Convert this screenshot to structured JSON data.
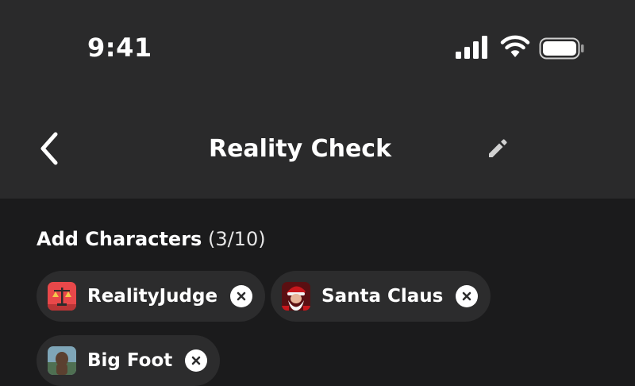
{
  "status_bar": {
    "time": "9:41",
    "icons": [
      "signal-icon",
      "wifi-icon",
      "battery-icon"
    ]
  },
  "nav": {
    "back_icon": "chevron-left-icon",
    "title": "Reality Check",
    "edit_icon": "pencil-icon"
  },
  "add_characters": {
    "heading": "Add Characters",
    "count": "(3/10)",
    "chips": [
      {
        "label": "RealityJudge",
        "avatar": "scales-avatar",
        "remove_icon": "close-circle-icon"
      },
      {
        "label": "Santa Claus",
        "avatar": "santa-avatar",
        "remove_icon": "close-circle-icon"
      },
      {
        "label": "Big Foot",
        "avatar": "bigfoot-avatar",
        "remove_icon": "close-circle-icon"
      }
    ]
  },
  "colors": {
    "background": "#1b1b1c",
    "header_background": "#2a2a2b",
    "chip_background": "#2c2c2d",
    "text": "#ffffff"
  }
}
